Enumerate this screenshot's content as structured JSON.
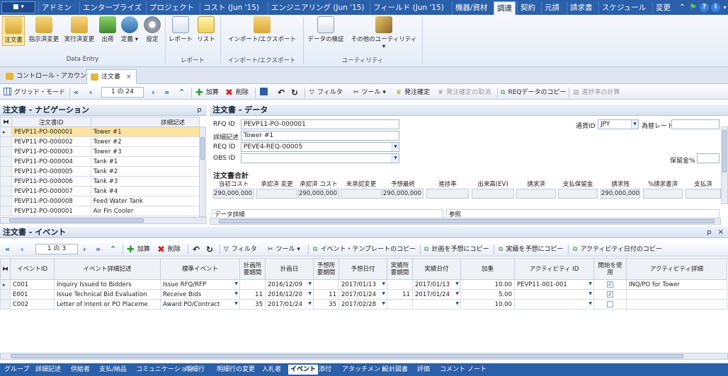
{
  "app_menu": {
    "label": "■ ▾"
  },
  "top_tabs": [
    "アドミン",
    "エンタープライズ",
    "プロジェクト",
    "コスト (Jun '15)",
    "エンジニアリング (Jun '15)",
    "フィールド (Jun '15)",
    "機器/資材",
    "調達",
    "契約",
    "元請",
    "請求書",
    "スケジュール",
    "変更"
  ],
  "top_active_tab": "調達",
  "ribbon": {
    "buttons": [
      "注文書",
      "指示済変更",
      "実行済変更",
      "出荷",
      "定義",
      "設定",
      "レポート",
      "リスト",
      "インポート/エクスポート",
      "データの検証",
      "その他のユーティリティ"
    ],
    "groups": [
      "Data Entry",
      "レポート",
      "インポート/エクスポート",
      "ユーティリティ"
    ]
  },
  "doc_tabs": {
    "tab1": "コントロール・アカウント",
    "tab2": "注文書",
    "close": "×"
  },
  "toolbar1": {
    "grid_mode": "グリッド・モード",
    "pager": "1 の 24",
    "add": "加算",
    "delete": "削除",
    "filter": "フィルタ",
    "tools": "ツール",
    "order_confirm": "発注確定",
    "order_cancel": "発注確定の取消",
    "req_copy": "REQデータのコピー",
    "progress_calc": "進捗率の計算"
  },
  "nav_panel": {
    "title": "注文書 - ナビゲーション",
    "pin": "ｐ",
    "col_id": "注文書ID",
    "col_desc": "詳細記述",
    "rows": [
      [
        "PEVP11-PO-000001",
        "Tower #1"
      ],
      [
        "PEVP11-PO-000002",
        "Tower #2"
      ],
      [
        "PEVP11-PO-000003",
        "Tower #3"
      ],
      [
        "PEVP11-PO-000004",
        "Tank #1"
      ],
      [
        "PEVP11-PO-000005",
        "Tank #2"
      ],
      [
        "PEVP11-PO-000006",
        "Tank #3"
      ],
      [
        "PEVP11-PO-000007",
        "Tank #4"
      ],
      [
        "PEVP11-PO-000008",
        "Feed Water Tank"
      ],
      [
        "PEVP12-PO-000001",
        "Air Fin Cooler"
      ]
    ]
  },
  "data_panel": {
    "title": "注文書 - データ",
    "rfq_label": "RFQ ID",
    "rfq_value": "PEVP11-PO-000001",
    "desc_label": "詳細記述",
    "desc_value": "Tower #1",
    "req_label": "REQ ID",
    "req_value": "PEVE4-REQ-00005",
    "obs_label": "OBS ID",
    "obs_value": "",
    "currency_label": "通貨ID",
    "currency_value": "JPY",
    "rate_label": "為替レート",
    "retention_label": "保留金%",
    "totals_title": "注文書合計",
    "totals_headers": [
      "当初コスト",
      "承認済 変更",
      "承認済 コスト",
      "未承認変更",
      "予想最終",
      "進捗率",
      "出来高(EV)",
      "請求済",
      "支払保留金",
      "請求残",
      "%請求書済",
      "支払済"
    ],
    "totals_values": [
      "290,000,000",
      "",
      "290,000,000",
      "",
      "290,000,000",
      "",
      "",
      "",
      "",
      "290,000,000",
      "",
      ""
    ],
    "section_left": "データ詳細",
    "section_right": "参照"
  },
  "events_panel": {
    "title": "注文書 - イベント",
    "pin": "ｐ",
    "close": "×",
    "pager": "1 の 3",
    "add": "加算",
    "delete": "削除",
    "filter": "フィルタ",
    "tools": "ツール",
    "tpl_copy": "イベント・テンプレートのコピー",
    "plan_copy": "計画を予想にコピー",
    "actual_copy": "実績を予想にコピー",
    "act_date_copy": "アクティビティ日付のコピー",
    "headers": [
      "イベントID",
      "イベント詳細記述",
      "標準イベント",
      "計画所要期間",
      "計画日",
      "予想所要期間",
      "予想日付",
      "実績所要期間",
      "実績日付",
      "加重",
      "アクティビティ ID",
      "開始を使用",
      "アクティビティ詳細"
    ],
    "rows": [
      {
        "id": "C001",
        "desc": "Inquiry Issued to Bidders",
        "std": "Issue RFQ/RFP",
        "pdur": "",
        "pdate": "2016/12/09",
        "fdur": "",
        "fdate": "2017/01/13",
        "adur": "",
        "adate": "2017/01/13",
        "weight": "10.00",
        "act": "PEVP11-001-001",
        "start": "✓",
        "actdesc": "INQ/PO for Tower"
      },
      {
        "id": "E001",
        "desc": "Issue Technical Bid Evaluation",
        "std": "Receive Bids",
        "pdur": "11",
        "pdate": "2016/12/20",
        "fdur": "11",
        "fdate": "2017/01/24",
        "adur": "11",
        "adate": "2017/01/24",
        "weight": "5.00",
        "act": "",
        "start": "✓",
        "actdesc": ""
      },
      {
        "id": "C002",
        "desc": "Letter of Intent or PO Placeme",
        "std": "Award PO/Contract",
        "pdur": "35",
        "pdate": "2017/01/24",
        "fdur": "35",
        "fdate": "2017/02/28",
        "adur": "",
        "adate": "",
        "weight": "10.00",
        "act": "",
        "start": "",
        "actdesc": ""
      }
    ]
  },
  "bottom_tabs": [
    "グループ",
    "詳細記述",
    "供給者",
    "支払/納品",
    "コミュニケーション",
    "明細行",
    "明細行の変更",
    "入札者",
    "イベント",
    "添付",
    "アタッチメント",
    "設計図書",
    "評価",
    "コメント",
    "ノート"
  ],
  "bottom_active": "イベント",
  "colors": {
    "brand_blue": "#2a5faa",
    "selection": "#fde4a1",
    "ribbon_select": "#fde8a6"
  }
}
